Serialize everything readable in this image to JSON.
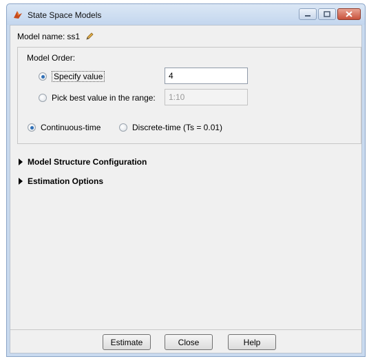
{
  "window": {
    "title": "State Space Models",
    "icons": {
      "app": "matlab-logo-icon",
      "minimize": "minimize-icon",
      "maximize": "maximize-icon",
      "close": "close-icon"
    }
  },
  "model_name": {
    "label": "Model name:",
    "value": "ss1",
    "edit_icon": "pencil-icon"
  },
  "model_order": {
    "label": "Model Order:",
    "specify": {
      "label": "Specify value",
      "value": "4",
      "selected": true
    },
    "pick_best": {
      "label": "Pick best value in the range:",
      "value": "1:10",
      "selected": false
    },
    "continuous": {
      "label": "Continuous-time",
      "selected": true
    },
    "discrete": {
      "label": "Discrete-time (Ts = 0.01)",
      "selected": false
    }
  },
  "sections": {
    "structure": "Model Structure Configuration",
    "estimation": "Estimation Options"
  },
  "buttons": {
    "estimate": "Estimate",
    "close": "Close",
    "help": "Help"
  },
  "colors": {
    "radio_dot": "#2f6fb6",
    "title_bar": "#c3d6ee",
    "close_btn": "#c9523b"
  }
}
